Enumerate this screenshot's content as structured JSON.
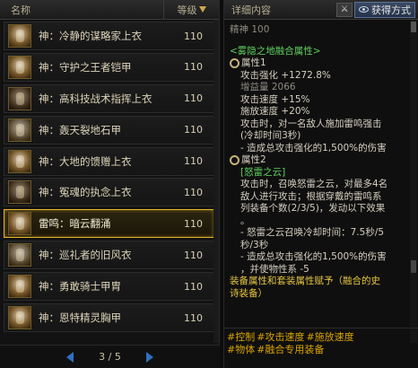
{
  "list": {
    "header_name": "名称",
    "header_level": "等级",
    "items": [
      {
        "name": "神：冷静的谋略家上衣",
        "level": "110",
        "selected": false
      },
      {
        "name": "神：守护之王者铠甲",
        "level": "110",
        "selected": false
      },
      {
        "name": "神：高科技战术指挥上衣",
        "level": "110",
        "selected": false
      },
      {
        "name": "神：轰天裂地石甲",
        "level": "110",
        "selected": false
      },
      {
        "name": "神：大地的馈赠上衣",
        "level": "110",
        "selected": false
      },
      {
        "name": "神：冤魂的执念上衣",
        "level": "110",
        "selected": false
      },
      {
        "name": "雷鸣：暗云翻涌",
        "level": "110",
        "selected": true
      },
      {
        "name": "神：巡礼者的旧风衣",
        "level": "110",
        "selected": false
      },
      {
        "name": "神：勇敢骑士甲胄",
        "level": "110",
        "selected": false
      },
      {
        "name": "神：恩特精灵胸甲",
        "level": "110",
        "selected": false
      }
    ],
    "page": "3 / 5"
  },
  "detail": {
    "header_title": "详细内容",
    "how_get": "获得方式",
    "spirit": "精神 100",
    "fusion_title": "<雾隐之地融合属性>",
    "prop1_title": "属性1",
    "prop1_lines": [
      "攻击强化 +1272.8%",
      "增益量 2066",
      "攻击速度 +15%",
      "施放速度 +20%",
      "攻击时，对一名敌人施加雷鸣强击",
      "(冷却时间3秒)",
      "- 造成总攻击强化的1,500%的伤害"
    ],
    "prop2_title": "属性2",
    "prop2_name": "[怒雷之云]",
    "prop2_lines": [
      "攻击时，召唤怒雷之云，对最多4名",
      "敌人进行攻击；根据穿戴的雷鸣系",
      "列装备个数(2/3/5)，发动以下效果",
      "。",
      "- 怒雷之云召唤冷却时间：7.5秒/5",
      "秒/3秒",
      "- 造成总攻击强化的1,500%的伤害",
      "，并使物性系 -5"
    ],
    "footer_note_1": "装备属性和套装属性赋予（融合的史",
    "footer_note_2": "诗装备）",
    "tags_line_1": [
      "#控制",
      "#攻击速度",
      "#施放速度"
    ],
    "tags_line_2": [
      "#物体",
      "#融合专用装备"
    ]
  },
  "colors": {
    "accent_gold": "#e6b42c",
    "green_text": "#5fd05f",
    "tag_orange": "#d9a400"
  }
}
